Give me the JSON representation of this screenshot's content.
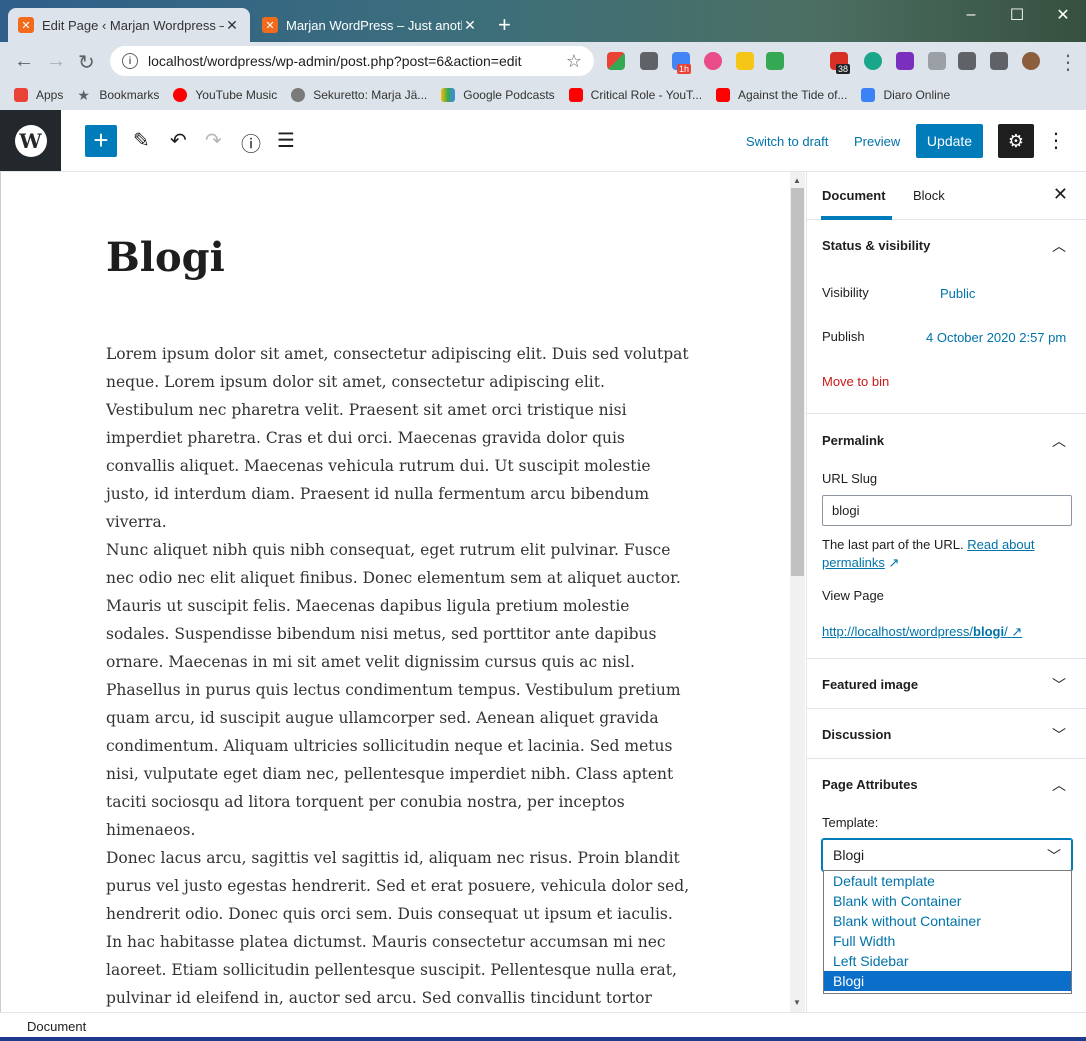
{
  "browser": {
    "tabs": [
      {
        "title": "Edit Page ‹ Marjan Wordpress —",
        "active": true
      },
      {
        "title": "Marjan WordPress – Just another",
        "active": false
      }
    ],
    "address": "localhost/wordpress/wp-admin/post.php?post=6&action=edit",
    "bookmarks": [
      {
        "label": "Apps",
        "icon": "apps-grid-icon",
        "color": "#ea4335"
      },
      {
        "label": "Bookmarks",
        "icon": "star-icon",
        "color": "#5f6368"
      },
      {
        "label": "YouTube Music",
        "icon": "youtube-music-icon",
        "color": "#ff0000"
      },
      {
        "label": "Sekuretto: Marja Jä...",
        "icon": "globe-icon",
        "color": "#7a7a7a"
      },
      {
        "label": "Google Podcasts",
        "icon": "podcasts-icon",
        "color": "#fbbc04"
      },
      {
        "label": "Critical Role - YouT...",
        "icon": "youtube-icon",
        "color": "#ff0000"
      },
      {
        "label": "Against the Tide of...",
        "icon": "youtube-icon",
        "color": "#ff0000"
      },
      {
        "label": "Diaro Online",
        "icon": "diaro-icon",
        "color": "#3b82f6"
      }
    ],
    "extension_badges": {
      "calendar": "1h",
      "mail": "38"
    }
  },
  "header": {
    "switch_to_draft": "Switch to draft",
    "preview": "Preview",
    "update": "Update"
  },
  "post": {
    "title": "Blogi",
    "paragraphs": [
      "Lorem ipsum dolor sit amet, consectetur adipiscing elit. Duis sed volutpat neque. Lorem ipsum dolor sit amet, consectetur adipiscing elit. Vestibulum nec pharetra velit. Praesent sit amet orci tristique nisi imperdiet pharetra. Cras et dui orci. Maecenas gravida dolor quis convallis aliquet. Maecenas vehicula rutrum dui. Ut suscipit molestie justo, id interdum diam. Praesent id nulla fermentum arcu bibendum viverra.",
      "Nunc aliquet nibh quis nibh consequat, eget rutrum elit pulvinar. Fusce nec odio nec elit aliquet finibus. Donec elementum sem at aliquet auctor. Mauris ut suscipit felis. Maecenas dapibus ligula pretium molestie sodales. Suspendisse bibendum nisi metus, sed porttitor ante dapibus ornare. Maecenas in mi sit amet velit dignissim cursus quis ac nisl. Phasellus in purus quis lectus condimentum tempus. Vestibulum pretium quam arcu, id suscipit augue ullamcorper sed. Aenean aliquet gravida condimentum. Aliquam ultricies sollicitudin neque et lacinia. Sed metus nisi, vulputate eget diam nec, pellentesque imperdiet nibh. Class aptent taciti sociosqu ad litora torquent per conubia nostra, per inceptos himenaeos.",
      "Donec lacus arcu, sagittis vel sagittis id, aliquam nec risus. Proin blandit purus vel justo egestas hendrerit. Sed et erat posuere, vehicula dolor sed, hendrerit odio. Donec quis orci sem. Duis consequat ut ipsum et iaculis. In hac habitasse platea dictumst. Mauris consectetur accumsan mi nec laoreet. Etiam sollicitudin pellentesque suscipit. Pellentesque nulla erat, pulvinar id eleifend in, auctor sed arcu. Sed convallis tincidunt tortor eget placerat. Ut"
    ]
  },
  "sidebar": {
    "tabs": {
      "document": "Document",
      "block": "Block"
    },
    "status": {
      "title": "Status & visibility",
      "visibility_label": "Visibility",
      "visibility_value": "Public",
      "publish_label": "Publish",
      "publish_value": "4 October 2020 2:57 pm",
      "trash": "Move to bin"
    },
    "permalink": {
      "title": "Permalink",
      "slug_label": "URL Slug",
      "slug_value": "blogi",
      "help_text": "The last part of the URL.",
      "help_link": "Read about permalinks",
      "view_label": "View Page",
      "url_prefix": "http://localhost/wordpress/",
      "url_slug": "blogi",
      "url_suffix": "/"
    },
    "featured_image": "Featured image",
    "discussion": "Discussion",
    "page_attributes": {
      "title": "Page Attributes",
      "template_label": "Template:",
      "template_value": "Blogi",
      "options": [
        "Default template",
        "Blank with Container",
        "Blank without Container",
        "Full Width",
        "Left Sidebar",
        "Blogi"
      ],
      "selected_index": 5
    }
  },
  "footer": {
    "breadcrumb": "Document"
  }
}
